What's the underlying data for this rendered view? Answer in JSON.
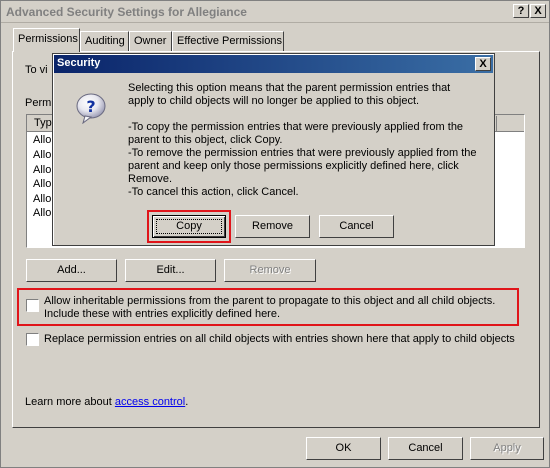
{
  "window": {
    "title": "Advanced Security Settings for Allegiance",
    "help_label": "?",
    "close_label": "X"
  },
  "tabs": [
    {
      "label": "Permissions"
    },
    {
      "label": "Auditing"
    },
    {
      "label": "Owner"
    },
    {
      "label": "Effective Permissions"
    }
  ],
  "permissions": {
    "intro_fragment": "To vi",
    "entries_label_fragment": "Permi",
    "column_fragment": "Typ",
    "rows": [
      "Allo",
      "Allo",
      "Allo",
      "Allo",
      "Allo",
      "Allo"
    ],
    "add_label": "Add...",
    "edit_label": "Edit...",
    "remove_label": "Remove",
    "inherit_checkbox_label": "Allow inheritable permissions from the parent to propagate to this object and all child objects. Include these with entries explicitly defined here.",
    "replace_checkbox_label": "Replace permission entries on all child objects with entries shown here that apply to child objects",
    "learn_more_text": "Learn more about",
    "learn_more_link": "access control",
    "learn_more_suffix": "."
  },
  "footer": {
    "ok_label": "OK",
    "cancel_label": "Cancel",
    "apply_label": "Apply"
  },
  "dialog": {
    "title": "Security",
    "close_label": "X",
    "icon": "question-icon",
    "message_1": "Selecting this option means that the parent permission entries that apply to child objects will no longer be applied to this object.",
    "message_2": "-To copy  the permission entries that were previously applied from the parent to this object, click Copy.",
    "message_3": "-To remove the permission entries that were previously applied from the parent and keep only those permissions explicitly defined here, click Remove.",
    "message_4": "-To cancel this action, click Cancel.",
    "copy_label": "Copy",
    "remove_label": "Remove",
    "cancel_label": "Cancel"
  },
  "colors": {
    "highlight_box": "#e0141a",
    "dialog_title_bar": "#0a246a",
    "link": "#0000ee"
  }
}
